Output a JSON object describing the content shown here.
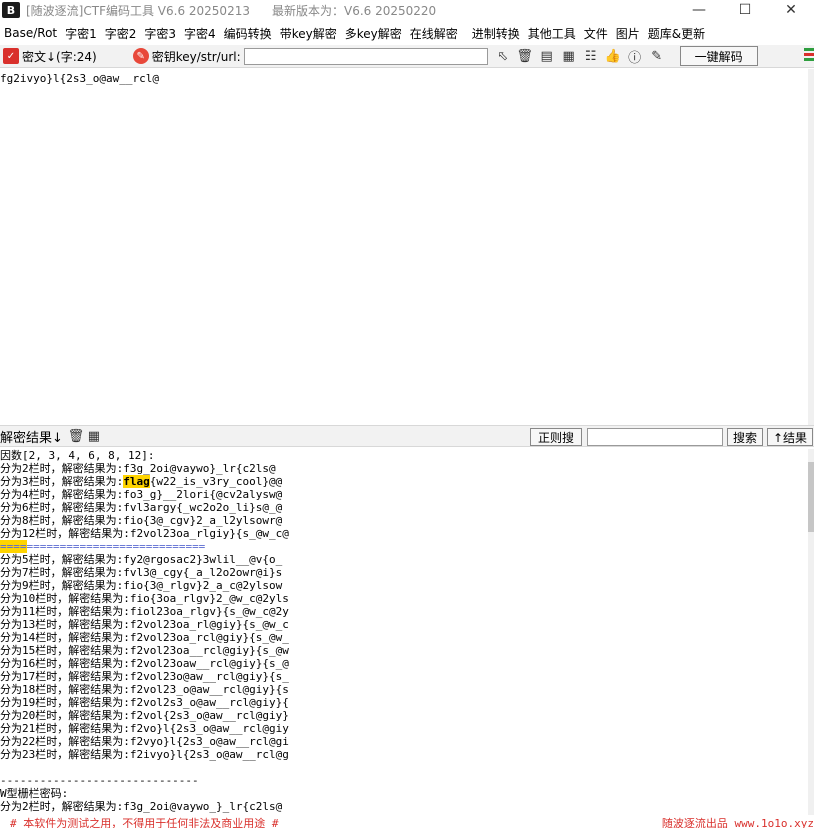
{
  "titlebar": {
    "icon_letter": "B",
    "title": "[随波逐流]CTF编码工具 V6.6 20250213",
    "latest": "最新版本为：V6.6 20250220"
  },
  "menu": {
    "items": [
      "Base/Rot",
      "字密1",
      "字密2",
      "字密3",
      "字密4",
      "编码转换",
      "带key解密",
      "多key解密",
      "在线解密",
      "进制转换",
      "其他工具",
      "文件",
      "图片",
      "题库&更新"
    ]
  },
  "toolbar": {
    "cipher_label": "密文↓(字:24)",
    "key_label": "密钥key/str/url:",
    "key_value": "",
    "decode_button": "一键解码"
  },
  "input": {
    "text": "fg2ivyo}l{2s3_o@aw__rcl@"
  },
  "result_bar": {
    "label": "解密结果↓",
    "regex_button": "正则搜",
    "search_value": "",
    "search_button": "搜索",
    "result_button": "↑结果"
  },
  "output": {
    "factors": "因数[2, 3, 4, 6, 8, 12]:",
    "lines_a": [
      {
        "prefix": "分为2栏时，解密结果为:",
        "value": "f3g_2oi@vaywo}_lr{c2ls@"
      },
      {
        "prefix": "分为3栏时，解密结果为:",
        "highlight": "flag",
        "value": "{w22_is_v3ry_cool}@@"
      },
      {
        "prefix": "分为4栏时，解密结果为:",
        "value": "fo3_g}__2lori{@cv2alysw@"
      },
      {
        "prefix": "分为6栏时，解密结果为:",
        "value": "fvl3argy{_wc2o2o_li}s@_@"
      },
      {
        "prefix": "分为8栏时，解密结果为:",
        "value": "fio{3@_cgv}2_a_l2ylsowr@"
      },
      {
        "prefix": "分为12栏时，解密结果为:",
        "value": "f2vol23oa_rlgiy}{s_@w_c@"
      }
    ],
    "separator_hl": "====",
    "separator": "===========================",
    "lines_b": [
      {
        "prefix": "分为5栏时，解密结果为:",
        "value": "fy2@rgosac2}3wlil__@v{o_"
      },
      {
        "prefix": "分为7栏时，解密结果为:",
        "value": "fvl3@_cgy{_a_l2o2owr@i}s"
      },
      {
        "prefix": "分为9栏时，解密结果为:",
        "value": "fio{3@_rlgv}2_a_c@2ylsow"
      },
      {
        "prefix": "分为10栏时，解密结果为:",
        "value": "fio{3oa_rlgv}2_@w_c@2yls"
      },
      {
        "prefix": "分为11栏时，解密结果为:",
        "value": "fiol23oa_rlgv}{s_@w_c@2y"
      },
      {
        "prefix": "分为13栏时，解密结果为:",
        "value": "f2vol23oa_rl@giy}{s_@w_c"
      },
      {
        "prefix": "分为14栏时，解密结果为:",
        "value": "f2vol23oa_rcl@giy}{s_@w_"
      },
      {
        "prefix": "分为15栏时，解密结果为:",
        "value": "f2vol23oa__rcl@giy}{s_@w"
      },
      {
        "prefix": "分为16栏时，解密结果为:",
        "value": "f2vol23oaw__rcl@giy}{s_@"
      },
      {
        "prefix": "分为17栏时，解密结果为:",
        "value": "f2vol23o@aw__rcl@giy}{s_"
      },
      {
        "prefix": "分为18栏时，解密结果为:",
        "value": "f2vol23_o@aw__rcl@giy}{s"
      },
      {
        "prefix": "分为19栏时，解密结果为:",
        "value": "f2vol2s3_o@aw__rcl@giy}{"
      },
      {
        "prefix": "分为20栏时，解密结果为:",
        "value": "f2vol{2s3_o@aw__rcl@giy}"
      },
      {
        "prefix": "分为21栏时，解密结果为:",
        "value": "f2vo}l{2s3_o@aw__rcl@giy"
      },
      {
        "prefix": "分为22栏时，解密结果为:",
        "value": "f2vyo}l{2s3_o@aw__rcl@gi"
      },
      {
        "prefix": "分为23栏时，解密结果为:",
        "value": "f2ivyo}l{2s3_o@aw__rcl@g"
      }
    ],
    "dash_line": "------------------------------",
    "w_title": "W型栅栏密码:",
    "w_first": {
      "prefix": "分为2栏时，解密结果为:",
      "value": "f3g_2oi@vaywo_}_lr{c2ls@"
    }
  },
  "status": {
    "left": "# 本软件为测试之用，不得用于任何非法及商业用途 #",
    "right": "随波逐流出品 www.1o1o.xyz"
  }
}
